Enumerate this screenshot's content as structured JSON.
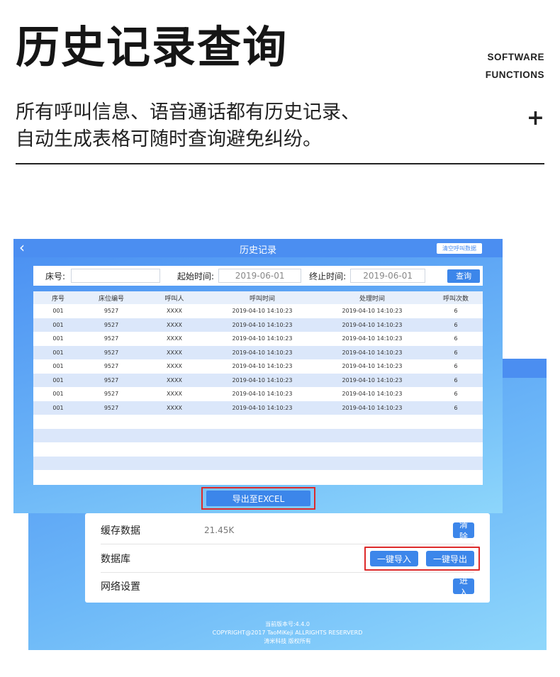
{
  "header": {
    "title": "历史记录查询",
    "software_line1": "SOFTWARE",
    "software_line2": "FUNCTIONS",
    "desc_line1": "所有呼叫信息、语音通话都有历史记录、",
    "desc_line2": "自动生成表格可随时查询避免纠纷。",
    "plus": "+"
  },
  "history": {
    "back_glyph": "‹",
    "title": "历史记录",
    "clear_button": "清空呼叫数据",
    "bed_label": "床号:",
    "bed_value": "",
    "start_label": "起始时间:",
    "start_value": "2019-06-01",
    "end_label": "终止时间:",
    "end_value": "2019-06-01",
    "query_button": "查询",
    "columns": [
      "序号",
      "床位编号",
      "呼叫人",
      "呼叫时间",
      "处理时间",
      "呼叫次数"
    ],
    "rows": [
      [
        "001",
        "9527",
        "XXXX",
        "2019-04-10   14:10:23",
        "2019-04-10   14:10:23",
        "6"
      ],
      [
        "001",
        "9527",
        "XXXX",
        "2019-04-10   14:10:23",
        "2019-04-10   14:10:23",
        "6"
      ],
      [
        "001",
        "9527",
        "XXXX",
        "2019-04-10   14:10:23",
        "2019-04-10   14:10:23",
        "6"
      ],
      [
        "001",
        "9527",
        "XXXX",
        "2019-04-10   14:10:23",
        "2019-04-10   14:10:23",
        "6"
      ],
      [
        "001",
        "9527",
        "XXXX",
        "2019-04-10   14:10:23",
        "2019-04-10   14:10:23",
        "6"
      ],
      [
        "001",
        "9527",
        "XXXX",
        "2019-04-10   14:10:23",
        "2019-04-10   14:10:23",
        "6"
      ],
      [
        "001",
        "9527",
        "XXXX",
        "2019-04-10   14:10:23",
        "2019-04-10   14:10:23",
        "6"
      ],
      [
        "001",
        "9527",
        "XXXX",
        "2019-04-10   14:10:23",
        "2019-04-10   14:10:23",
        "6"
      ]
    ],
    "export_button": "导出至EXCEL"
  },
  "settings": {
    "cache_label": "缓存数据",
    "cache_value": "21.45K",
    "clear_button": "清除",
    "db_label": "数据库",
    "import_button": "一键导入",
    "export_button": "一键导出",
    "network_label": "网络设置",
    "enter_button": "进入"
  },
  "footer": {
    "version": "当前版本号:4.4.0",
    "copyright": "COPYRIGHT@2017 TaoMiKeji ALLRIGHTS RESERVERD",
    "company": "涛米科技 版权所有"
  },
  "colors": {
    "accent": "#3c86ea",
    "bar": "#4b8ef1",
    "highlight_border": "#dd2a2a"
  }
}
